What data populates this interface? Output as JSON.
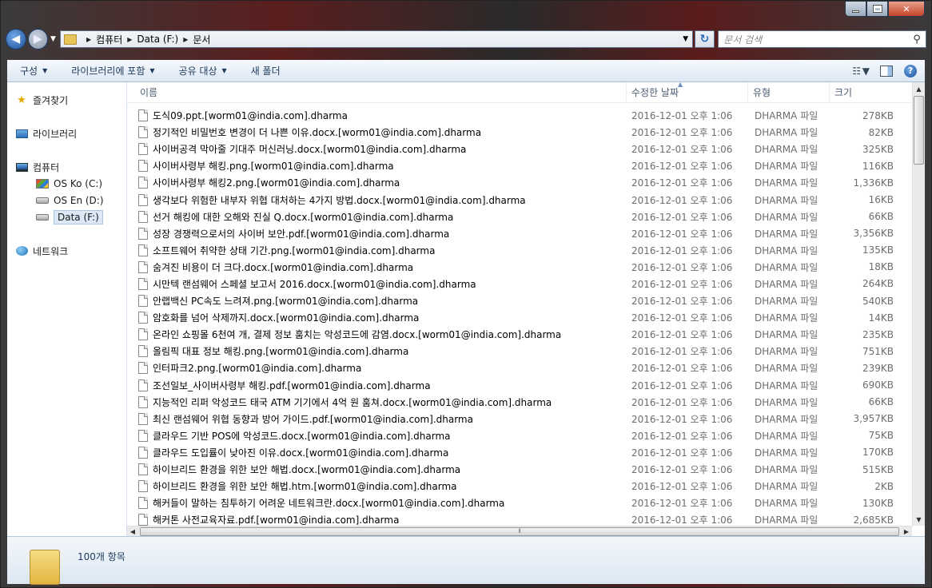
{
  "address": {
    "crumbs": [
      "컴퓨터",
      "Data (F:)",
      "문서"
    ],
    "search_placeholder": "문서 검색"
  },
  "toolbar": {
    "organize": "구성",
    "include_library": "라이브러리에 포함",
    "share": "공유 대상",
    "new_folder": "새 폴더"
  },
  "nav": {
    "favorites": "즐겨찾기",
    "libraries": "라이브러리",
    "computer": "컴퓨터",
    "drives": [
      "OS Ko (C:)",
      "OS En (D:)",
      "Data (F:)"
    ],
    "network": "네트워크"
  },
  "columns": {
    "name": "이름",
    "date": "수정한 날짜",
    "type": "유형",
    "size": "크기"
  },
  "files": [
    {
      "name": "도식09.ppt.[worm01@india.com].dharma",
      "date": "2016-12-01 오후 1:06",
      "type": "DHARMA 파일",
      "size": "278KB"
    },
    {
      "name": "정기적인 비밀번호 변경이 더 나쁜 이유.docx.[worm01@india.com].dharma",
      "date": "2016-12-01 오후 1:06",
      "type": "DHARMA 파일",
      "size": "82KB"
    },
    {
      "name": "사이버공격 막아줄 기대주 머신러닝.docx.[worm01@india.com].dharma",
      "date": "2016-12-01 오후 1:06",
      "type": "DHARMA 파일",
      "size": "325KB"
    },
    {
      "name": "사이버사령부 해킹.png.[worm01@india.com].dharma",
      "date": "2016-12-01 오후 1:06",
      "type": "DHARMA 파일",
      "size": "116KB"
    },
    {
      "name": "사이버사령부 해킹2.png.[worm01@india.com].dharma",
      "date": "2016-12-01 오후 1:06",
      "type": "DHARMA 파일",
      "size": "1,336KB"
    },
    {
      "name": "생각보다 위험한 내부자 위협 대처하는 4가지 방법.docx.[worm01@india.com].dharma",
      "date": "2016-12-01 오후 1:06",
      "type": "DHARMA 파일",
      "size": "16KB"
    },
    {
      "name": "선거 해킹에 대한 오해와 진실 Q.docx.[worm01@india.com].dharma",
      "date": "2016-12-01 오후 1:06",
      "type": "DHARMA 파일",
      "size": "66KB"
    },
    {
      "name": "성장 경쟁력으로서의 사이버 보안.pdf.[worm01@india.com].dharma",
      "date": "2016-12-01 오후 1:06",
      "type": "DHARMA 파일",
      "size": "3,356KB"
    },
    {
      "name": "소프트웨어 취약한 상태 기간.png.[worm01@india.com].dharma",
      "date": "2016-12-01 오후 1:06",
      "type": "DHARMA 파일",
      "size": "135KB"
    },
    {
      "name": "숨겨진 비용이 더 크다.docx.[worm01@india.com].dharma",
      "date": "2016-12-01 오후 1:06",
      "type": "DHARMA 파일",
      "size": "18KB"
    },
    {
      "name": "시만텍 랜섬웨어 스페셜 보고서 2016.docx.[worm01@india.com].dharma",
      "date": "2016-12-01 오후 1:06",
      "type": "DHARMA 파일",
      "size": "264KB"
    },
    {
      "name": "안랩백신 PC속도 느려져.png.[worm01@india.com].dharma",
      "date": "2016-12-01 오후 1:06",
      "type": "DHARMA 파일",
      "size": "540KB"
    },
    {
      "name": "암호화를 넘어 삭제까지.docx.[worm01@india.com].dharma",
      "date": "2016-12-01 오후 1:06",
      "type": "DHARMA 파일",
      "size": "14KB"
    },
    {
      "name": "온라인 쇼핑몰 6천여 개, 결제 정보 훔치는 악성코드에 감염.docx.[worm01@india.com].dharma",
      "date": "2016-12-01 오후 1:06",
      "type": "DHARMA 파일",
      "size": "235KB"
    },
    {
      "name": "올림픽 대표 정보 해킹.png.[worm01@india.com].dharma",
      "date": "2016-12-01 오후 1:06",
      "type": "DHARMA 파일",
      "size": "751KB"
    },
    {
      "name": "인터파크2.png.[worm01@india.com].dharma",
      "date": "2016-12-01 오후 1:06",
      "type": "DHARMA 파일",
      "size": "239KB"
    },
    {
      "name": "조선일보_사이버사령부 해킹.pdf.[worm01@india.com].dharma",
      "date": "2016-12-01 오후 1:06",
      "type": "DHARMA 파일",
      "size": "690KB"
    },
    {
      "name": "지능적인 리퍼 악성코드 태국 ATM 기기에서 4억 원 훔쳐.docx.[worm01@india.com].dharma",
      "date": "2016-12-01 오후 1:06",
      "type": "DHARMA 파일",
      "size": "66KB"
    },
    {
      "name": "최신 랜섬웨어 위협 동향과 방어 가이드.pdf.[worm01@india.com].dharma",
      "date": "2016-12-01 오후 1:06",
      "type": "DHARMA 파일",
      "size": "3,957KB"
    },
    {
      "name": "클라우드 기반 POS에 악성코드.docx.[worm01@india.com].dharma",
      "date": "2016-12-01 오후 1:06",
      "type": "DHARMA 파일",
      "size": "75KB"
    },
    {
      "name": "클라우드 도입률이 낮아진 이유.docx.[worm01@india.com].dharma",
      "date": "2016-12-01 오후 1:06",
      "type": "DHARMA 파일",
      "size": "170KB"
    },
    {
      "name": "하이브리드 환경을 위한 보안 해법.docx.[worm01@india.com].dharma",
      "date": "2016-12-01 오후 1:06",
      "type": "DHARMA 파일",
      "size": "515KB"
    },
    {
      "name": "하이브리드 환경을 위한 보안 해법.htm.[worm01@india.com].dharma",
      "date": "2016-12-01 오후 1:06",
      "type": "DHARMA 파일",
      "size": "2KB"
    },
    {
      "name": "해커들이 말하는 침투하기 어려운 네트워크란.docx.[worm01@india.com].dharma",
      "date": "2016-12-01 오후 1:06",
      "type": "DHARMA 파일",
      "size": "130KB"
    },
    {
      "name": "해커톤 사전교육자료.pdf.[worm01@india.com].dharma",
      "date": "2016-12-01 오후 1:06",
      "type": "DHARMA 파일",
      "size": "2,685KB"
    }
  ],
  "status": {
    "count": "100개 항목"
  }
}
